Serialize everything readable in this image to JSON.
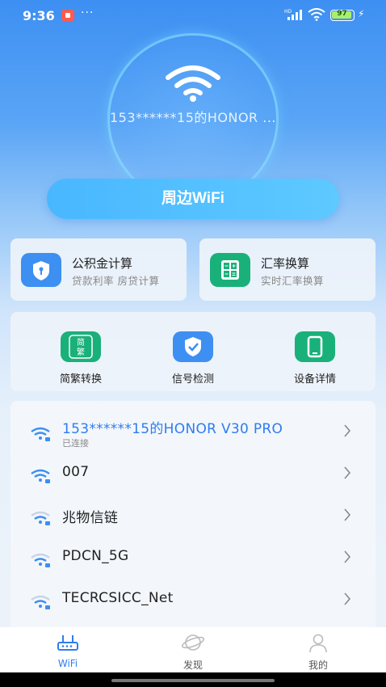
{
  "status_bar": {
    "time": "9:36",
    "dots": "···",
    "battery": "97",
    "network": "HD"
  },
  "hero": {
    "ssid": "153******15的HONOR ..."
  },
  "nearby_button": {
    "label": "周边WiFi"
  },
  "features": [
    {
      "title": "公积金计算",
      "subtitle": "贷款利率  房贷计算",
      "icon": "shield-lock-icon",
      "color": "#3d8ff2"
    },
    {
      "title": "汇率换算",
      "subtitle": "实时汇率换算",
      "icon": "calculator-icon",
      "color": "#1ab07a"
    }
  ],
  "tools": [
    {
      "label": "简繁转换",
      "icon": "simplified-traditional-icon",
      "icon_text": "简繁",
      "color": "#1ab07a"
    },
    {
      "label": "信号检测",
      "icon": "shield-check-icon",
      "color": "#3d8ff2"
    },
    {
      "label": "设备详情",
      "icon": "tablet-icon",
      "color": "#1ab07a"
    }
  ],
  "wifi_list": [
    {
      "name": "153******15的HONOR V30 PRO",
      "status": "已连接",
      "connected": true,
      "locked": true
    },
    {
      "name": "007",
      "locked": true
    },
    {
      "name": "兆物信链",
      "locked": true
    },
    {
      "name": "PDCN_5G",
      "locked": true
    },
    {
      "name": "TECRCSICC_Net",
      "locked": true
    }
  ],
  "tabs": [
    {
      "label": "WiFi",
      "icon": "router-icon",
      "active": true
    },
    {
      "label": "发现",
      "icon": "planet-icon",
      "active": false
    },
    {
      "label": "我的",
      "icon": "user-icon",
      "active": false
    }
  ],
  "colors": {
    "accent": "#2f7cf0",
    "green": "#1ab07a",
    "blue": "#3d8ff2"
  }
}
